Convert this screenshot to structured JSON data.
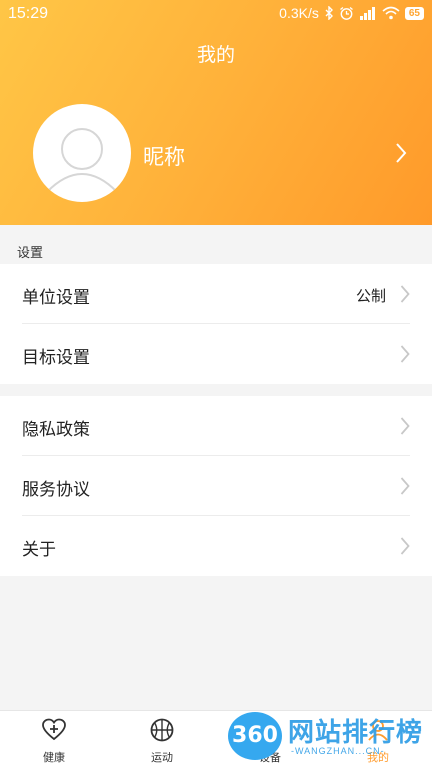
{
  "status": {
    "time": "15:29",
    "speed": "0.3K/s",
    "battery": "65",
    "icons": [
      "bluetooth-icon",
      "alarm-icon",
      "signal-icon",
      "wifi-icon",
      "battery-icon"
    ]
  },
  "header": {
    "title": "我的",
    "nickname": "昵称"
  },
  "settings": {
    "section_label": "设置",
    "unit_label": "单位设置",
    "unit_value": "公制",
    "goal_label": "目标设置"
  },
  "info": {
    "privacy_label": "隐私政策",
    "terms_label": "服务协议",
    "about_label": "关于"
  },
  "tabs": {
    "health": "健康",
    "sport": "运动",
    "device": "设备",
    "mine": "我的"
  },
  "watermark": {
    "badge": "360",
    "title": "网站排行榜",
    "subtitle": "-WANGZHAN...CN-"
  },
  "colors": {
    "accent": "#ff9c2e",
    "header_start": "#ffc646",
    "header_end": "#ff9a2a",
    "watermark_blue": "#2e9de6"
  }
}
